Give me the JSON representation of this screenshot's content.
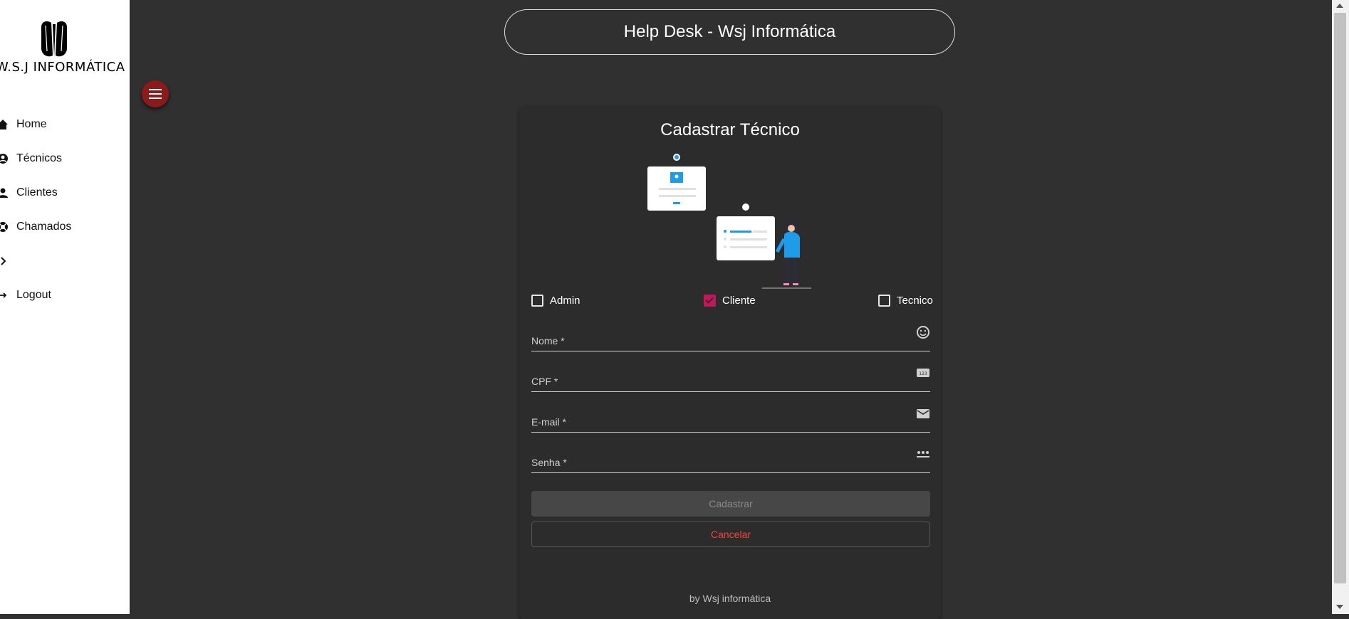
{
  "sidebar": {
    "logo_text": "W.S.J INFORMÁTICA",
    "items": [
      {
        "label": "Home",
        "icon": "home-icon"
      },
      {
        "label": "Técnicos",
        "icon": "account-circle-icon"
      },
      {
        "label": "Clientes",
        "icon": "person-icon"
      },
      {
        "label": "Chamados",
        "icon": "support-icon"
      },
      {
        "label": "",
        "icon": "chevron-right-icon"
      },
      {
        "label": "Logout",
        "icon": "logout-icon"
      }
    ]
  },
  "header": {
    "title": "Help Desk - Wsj Informática"
  },
  "form": {
    "title": "Cadastrar Técnico",
    "profiles": [
      {
        "label": "Admin",
        "checked": false
      },
      {
        "label": "Cliente",
        "checked": true
      },
      {
        "label": "Tecnico",
        "checked": false
      }
    ],
    "fields": [
      {
        "label": "Nome *",
        "icon": "smiley-icon"
      },
      {
        "label": "CPF *",
        "icon": "numbers-123-icon"
      },
      {
        "label": "E-mail *",
        "icon": "mail-icon"
      },
      {
        "label": "Senha *",
        "icon": "password-icon"
      }
    ],
    "submit_label": "Cadastrar",
    "cancel_label": "Cancelar",
    "footer": "by Wsj informática"
  },
  "colors": {
    "background": "#303030",
    "card": "#2c2c2c",
    "accent_checked": "#c2185b",
    "cancel_text": "#f44336",
    "menu_button": "#8b1b1b"
  }
}
